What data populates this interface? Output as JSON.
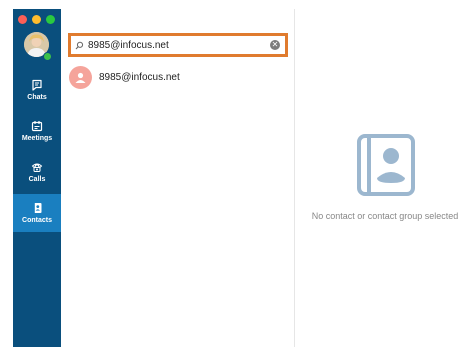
{
  "window": {
    "controls": [
      "close",
      "minimize",
      "zoom"
    ]
  },
  "sidebar": {
    "avatar_icon": "user-photo",
    "items": [
      {
        "label": "Chats",
        "icon": "chat-icon",
        "active": false
      },
      {
        "label": "Meetings",
        "icon": "calendar-icon",
        "active": false
      },
      {
        "label": "Calls",
        "icon": "phone-icon",
        "active": false
      },
      {
        "label": "Contacts",
        "icon": "contacts-book-icon",
        "active": true
      }
    ]
  },
  "search": {
    "value": "8985@infocus.net",
    "highlight_color": "#e07b2e"
  },
  "results": [
    {
      "name": "8985@infocus.net",
      "avatar_color": "#f5a49b"
    }
  ],
  "detail": {
    "empty_message": "No contact or contact group selected"
  },
  "colors": {
    "sidebar": "#0a4f7d",
    "sidebar_active": "#1a7fc0"
  }
}
